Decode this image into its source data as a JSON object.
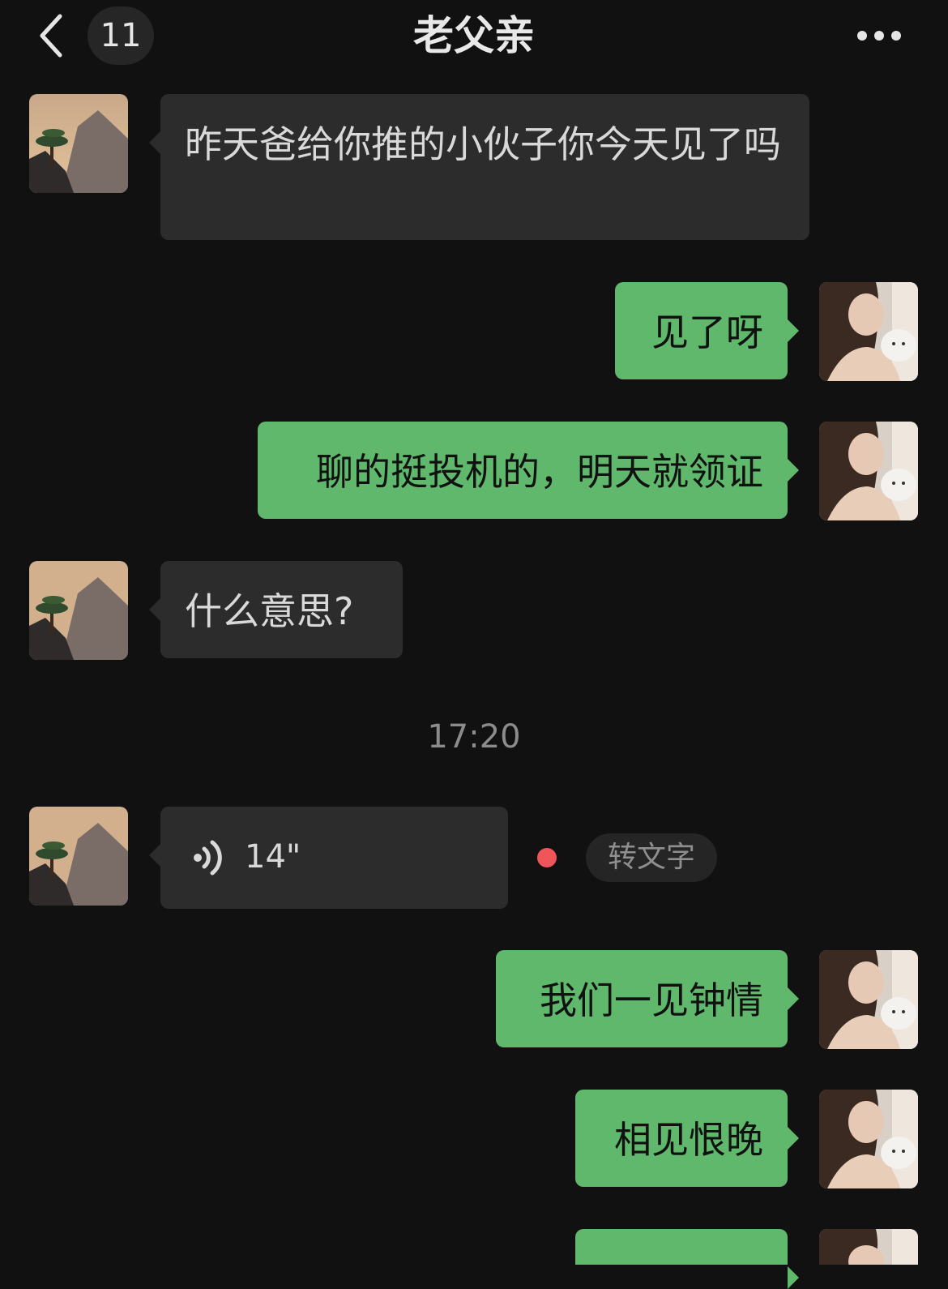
{
  "header": {
    "back_icon": "chevron-left-icon",
    "unread_count": "11",
    "title": "老父亲",
    "more_icon": "ellipsis-icon"
  },
  "messages": [
    {
      "from": "father",
      "text": "昨天爸给你推的小伙子你今天见了吗"
    },
    {
      "from": "me",
      "text": "见了呀"
    },
    {
      "from": "me",
      "text": "聊的挺投机的，明天就领证"
    },
    {
      "from": "father",
      "text": "什么意思?"
    },
    {
      "from": "me",
      "text": "我们一见钟情"
    },
    {
      "from": "me",
      "text": "相见恨晚"
    }
  ],
  "timestamp": "17:20",
  "voice_message": {
    "from": "father",
    "duration": "14\"",
    "icon": "voice-wave-icon",
    "unread_dot_color": "#f0555a",
    "convert_label": "转文字"
  },
  "colors": {
    "background": "#111111",
    "incoming_bubble": "#2c2c2c",
    "outgoing_bubble": "#5fb86b"
  }
}
